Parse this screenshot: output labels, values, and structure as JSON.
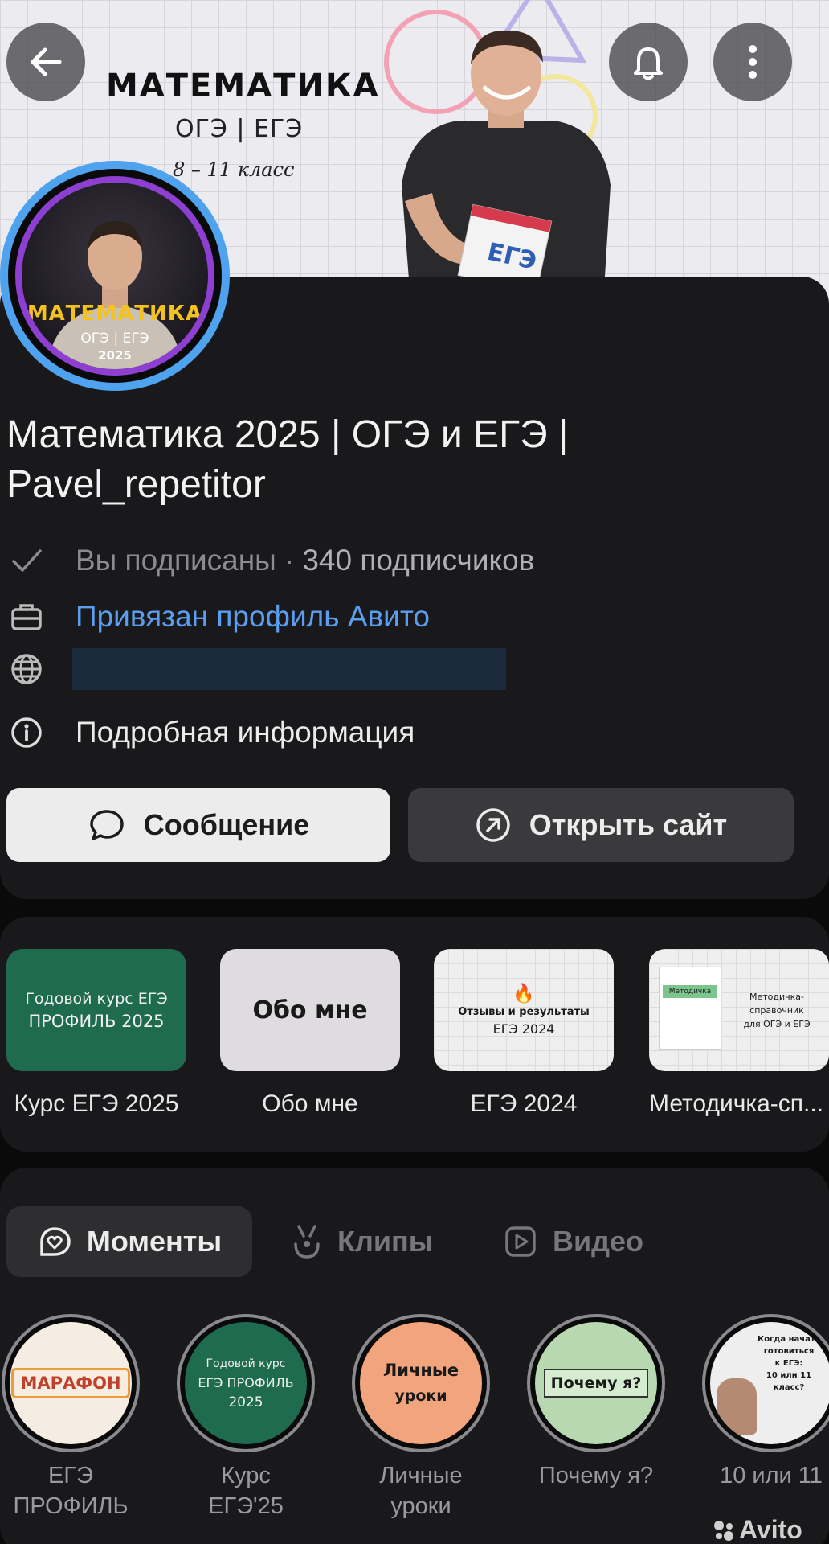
{
  "cover": {
    "title": "МАТЕМАТИКА",
    "subtitle": "ОГЭ | ЕГЭ",
    "grade": "8 – 11 класс",
    "book_text": "ЕГЭ"
  },
  "avatar": {
    "line1": "МАТЕМАТИКА",
    "line2": "ОГЭ | ЕГЭ",
    "line3": "2025"
  },
  "profile": {
    "name": "Математика 2025 | ОГЭ и ЕГЭ | Pavel_repetitor",
    "subscribed_text": "Вы подписаны · ",
    "subscribers": "340 подписчиков",
    "linked_profile": "Привязан профиль Авито",
    "details": "Подробная информация"
  },
  "actions": {
    "message": "Сообщение",
    "open_site": "Открыть сайт"
  },
  "highlights": [
    {
      "label": "Курс ЕГЭ 2025",
      "thumb_line1": "Годовой курс ЕГЭ",
      "thumb_line2": "ПРОФИЛЬ 2025"
    },
    {
      "label": "Обо мне",
      "thumb_line1": "Обо мне"
    },
    {
      "label": "ЕГЭ 2024",
      "thumb_line1": "Отзывы и результаты",
      "thumb_line2": "ЕГЭ 2024"
    },
    {
      "label": "Методичка-сп...",
      "thumb_line1": "Методичка-",
      "thumb_line2": "справочник",
      "thumb_line3": "для ОГЭ и ЕГЭ",
      "thumb_tag": "Методичка"
    }
  ],
  "tabs": {
    "moments": "Моменты",
    "clips": "Клипы",
    "video": "Видео"
  },
  "moments": [
    {
      "label": "ЕГЭ\nПРОФИЛЬ",
      "thumb": "МАРАФОН"
    },
    {
      "label": "Курс\nЕГЭ'25",
      "thumb_line1": "Годовой курс",
      "thumb_line2": "ЕГЭ ПРОФИЛЬ",
      "thumb_line3": "2025"
    },
    {
      "label": "Личные\nуроки",
      "thumb_line1": "Личные",
      "thumb_line2": "уроки"
    },
    {
      "label": "Почему я?",
      "thumb": "Почему я?"
    },
    {
      "label": "10 или 11",
      "thumb_line1": "Когда начать",
      "thumb_line2": "готовиться",
      "thumb_line3": "к ЕГЭ:",
      "thumb_line4": "10 или 11",
      "thumb_line5": "класс?"
    }
  ],
  "watermark": "Avito",
  "colors": {
    "link": "#5b9ef0",
    "avatar_ring": "#4ea2ee",
    "avatar_inner_ring": "#8c3fd0",
    "card_bg": "#19191b",
    "page_bg": "#0a0a0b"
  }
}
